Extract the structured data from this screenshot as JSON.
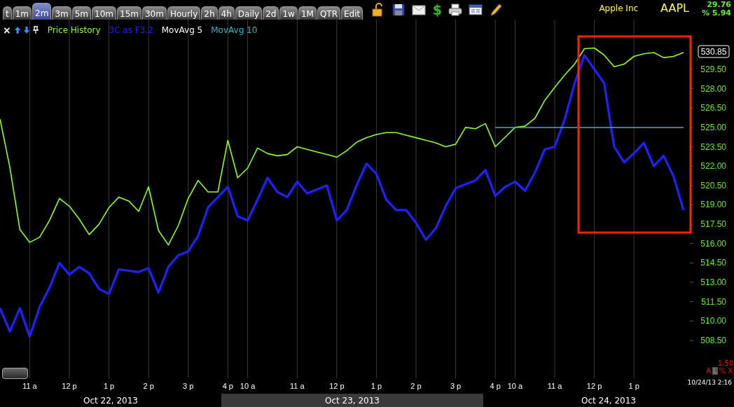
{
  "tabs": [
    {
      "label": "t",
      "selected": false
    },
    {
      "label": "1m",
      "selected": false
    },
    {
      "label": "2m",
      "selected": true
    },
    {
      "label": "3m",
      "selected": false
    },
    {
      "label": "5m",
      "selected": false
    },
    {
      "label": "10m",
      "selected": false
    },
    {
      "label": "15m",
      "selected": false
    },
    {
      "label": "30m",
      "selected": false
    },
    {
      "label": "Hourly",
      "selected": false
    },
    {
      "label": "2h",
      "selected": false
    },
    {
      "label": "4h",
      "selected": false
    },
    {
      "label": "Daily",
      "selected": false
    },
    {
      "label": "2d",
      "selected": false
    },
    {
      "label": "1w",
      "selected": false
    },
    {
      "label": "1M",
      "selected": false
    },
    {
      "label": "QTR",
      "selected": false
    },
    {
      "label": "Edit",
      "selected": false
    }
  ],
  "toolbar": [
    {
      "kind": "lock"
    },
    {
      "kind": "save"
    },
    {
      "kind": "mail"
    },
    {
      "kind": "dollar",
      "glyph": "$"
    },
    {
      "kind": "print"
    },
    {
      "kind": "window"
    },
    {
      "kind": "pencil"
    }
  ],
  "symbol": {
    "name": "Apple Inc",
    "ticker": "AAPL",
    "change": "29.76",
    "percent": "% 5.94"
  },
  "legend": {
    "close": "×",
    "entries": [
      {
        "label": "MovAvg 5",
        "color": "#ffffff"
      }
    ]
  },
  "chart": {
    "chart_data": {
      "type": "line",
      "grid": true,
      "ylim": [
        505.57,
        533.35
      ],
      "categories": [
        null,
        null,
        null,
        "11 a",
        null,
        null,
        null,
        "12 p",
        null,
        null,
        null,
        "1 p",
        null,
        null,
        null,
        "2 p",
        null,
        null,
        null,
        "3 p",
        null,
        null,
        null,
        "4 p",
        null,
        "10 a",
        null,
        null,
        null,
        null,
        "11 a",
        null,
        null,
        null,
        "12 p",
        null,
        null,
        null,
        "1 p",
        null,
        null,
        null,
        "2 p",
        null,
        null,
        null,
        "3 p",
        null,
        null,
        null,
        "4 p",
        null,
        "10 a",
        null,
        null,
        null,
        "11 a",
        null,
        null,
        null,
        "12 p",
        null,
        null,
        null,
        "1 p",
        null,
        null,
        null,
        null,
        null
      ],
      "series": [
        {
          "name": "Price History",
          "color": "#8cff1a",
          "values": [
            525.65,
            521.9,
            517.1,
            516.1,
            516.5,
            517.8,
            519.5,
            518.9,
            517.9,
            516.7,
            517.5,
            518.8,
            519.6,
            519.3,
            518.5,
            520.4,
            517.0,
            515.9,
            517.4,
            519.5,
            520.9,
            520.0,
            520.0,
            524.0,
            521.1,
            521.85,
            523.4,
            522.98,
            522.8,
            522.9,
            523.5,
            523.3,
            523.1,
            522.9,
            522.7,
            523.2,
            523.85,
            524.2,
            524.45,
            524.6,
            524.6,
            524.4,
            524.2,
            524.0,
            523.8,
            523.5,
            523.7,
            525.0,
            524.9,
            525.3,
            523.5,
            524.25,
            525.0,
            525.1,
            525.7,
            527.1,
            528.1,
            529.05,
            529.9,
            531.1,
            531.15,
            530.6,
            529.7,
            529.9,
            530.5,
            530.7,
            530.8,
            530.4,
            530.5,
            530.8
          ]
        },
        {
          "name": "3C as F3.2",
          "color": "#2020ff",
          "values": [
            511.0,
            509.2,
            511.0,
            508.8,
            511.1,
            512.6,
            514.5,
            513.6,
            514.2,
            513.7,
            512.5,
            512.1,
            514.0,
            513.9,
            513.8,
            514.1,
            512.2,
            514.2,
            515.1,
            515.4,
            516.6,
            518.8,
            519.6,
            520.4,
            518.1,
            517.8,
            519.4,
            521.1,
            520.0,
            519.6,
            520.8,
            519.9,
            520.2,
            520.5,
            517.8,
            518.6,
            520.5,
            522.2,
            521.4,
            519.4,
            518.6,
            518.6,
            517.6,
            516.3,
            517.2,
            518.9,
            520.3,
            520.6,
            520.9,
            521.7,
            519.7,
            520.4,
            520.8,
            520.1,
            521.5,
            523.3,
            523.5,
            525.6,
            528.4,
            530.6,
            529.5,
            528.4,
            523.5,
            522.3,
            523.0,
            523.8,
            522.0,
            522.8,
            521.2,
            518.6
          ]
        },
        {
          "name": "MovAvg 10",
          "color": "#2ab8c0",
          "values": [
            null,
            null,
            null,
            null,
            null,
            null,
            null,
            null,
            null,
            null,
            null,
            null,
            null,
            null,
            null,
            null,
            null,
            null,
            null,
            null,
            null,
            null,
            null,
            null,
            null,
            null,
            null,
            null,
            null,
            null,
            null,
            null,
            null,
            null,
            null,
            null,
            null,
            null,
            null,
            null,
            null,
            null,
            null,
            null,
            null,
            null,
            null,
            null,
            null,
            null,
            525.0,
            525.0,
            525.0,
            525.0,
            525.0,
            525.0,
            525.0,
            525.0,
            525.0,
            525.0,
            525.0,
            525.0,
            525.0,
            525.0,
            525.0,
            525.0,
            525.0,
            525.0,
            525.0,
            525.0
          ]
        }
      ],
      "yticks": [
        {
          "value": 529.5,
          "label": "529.50"
        },
        {
          "value": 528.0,
          "label": "528.00"
        },
        {
          "value": 526.5,
          "label": "526.50"
        },
        {
          "value": 525.0,
          "label": "525.00"
        },
        {
          "value": 523.5,
          "label": "523.50"
        },
        {
          "value": 522.0,
          "label": "522.00"
        },
        {
          "value": 520.5,
          "label": "520.50"
        },
        {
          "value": 519.0,
          "label": "519.00"
        },
        {
          "value": 517.5,
          "label": "517.50"
        },
        {
          "value": 516.0,
          "label": "516.00"
        },
        {
          "value": 514.5,
          "label": "514.50"
        },
        {
          "value": 513.0,
          "label": "513.00"
        },
        {
          "value": 511.5,
          "label": "511.50"
        },
        {
          "value": 510.0,
          "label": "510.00"
        },
        {
          "value": 508.5,
          "label": "508.50"
        }
      ]
    },
    "highlight": {
      "color": "#ff2200"
    },
    "current_price": "530.85",
    "date_band": [
      {
        "label": "Oct 22, 2013",
        "shaded": false
      },
      {
        "label": "Oct 23, 2013",
        "shaded": true
      },
      {
        "label": "Oct 24, 2013",
        "shaded": false
      }
    ]
  },
  "corner": {
    "step": "1.50",
    "buttons": [
      {
        "label": "A",
        "selected": false
      },
      {
        "label": "L",
        "selected": true
      },
      {
        "label": "%",
        "selected": false
      },
      {
        "label": "X",
        "selected": false
      }
    ],
    "timestamp": "10/24/13 2:16"
  }
}
